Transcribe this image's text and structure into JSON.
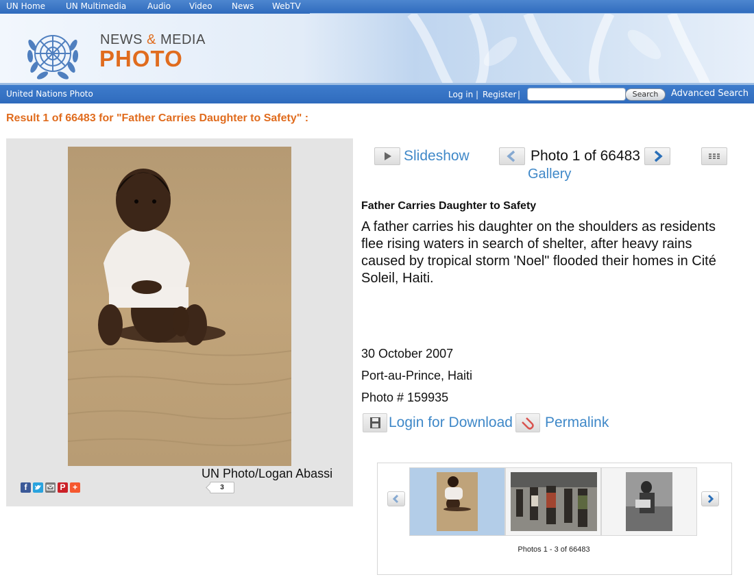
{
  "topnav": {
    "items": [
      "UN Home",
      "UN Multimedia",
      "Audio",
      "Video",
      "News",
      "WebTV"
    ]
  },
  "banner": {
    "news_word": "NEWS",
    "amp": "&",
    "media_word": "MEDIA",
    "photo_word": "PHOTO"
  },
  "subbar": {
    "brand": "United Nations Photo",
    "login": "Log in",
    "register": "Register",
    "search_value": "",
    "search_button": "Search",
    "advanced_search": "Advanced Search"
  },
  "result_heading": "Result 1 of 66483 for \"Father Carries Daughter to Safety\" :",
  "photo_panel": {
    "credit": "UN Photo/Logan Abassi",
    "share_count": "3",
    "share_icons": [
      "facebook-icon",
      "twitter-icon",
      "email-icon",
      "pinterest-icon",
      "addthis-icon"
    ]
  },
  "controls": {
    "slideshow": "Slideshow",
    "photo_counter": "Photo 1 of 66483",
    "gallery": "Gallery"
  },
  "details": {
    "title": "Father Carries Daughter to Safety",
    "description": "A father carries his daughter on the shoulders as residents flee rising waters in search of shelter, after heavy rains caused by tropical storm 'Noel\" flooded their homes in Cité Soleil, Haiti.",
    "date": "30 October 2007",
    "location": "Port-au-Prince, Haiti",
    "photo_number": "Photo # 159935",
    "download": "Login for Download",
    "permalink": "Permalink"
  },
  "carousel": {
    "caption": "Photos 1 - 3 of 66483",
    "selected_index": 0
  },
  "colors": {
    "accent_orange": "#e06c1e",
    "link_blue": "#3f88c8",
    "nav_blue": "#2f6bbd"
  }
}
